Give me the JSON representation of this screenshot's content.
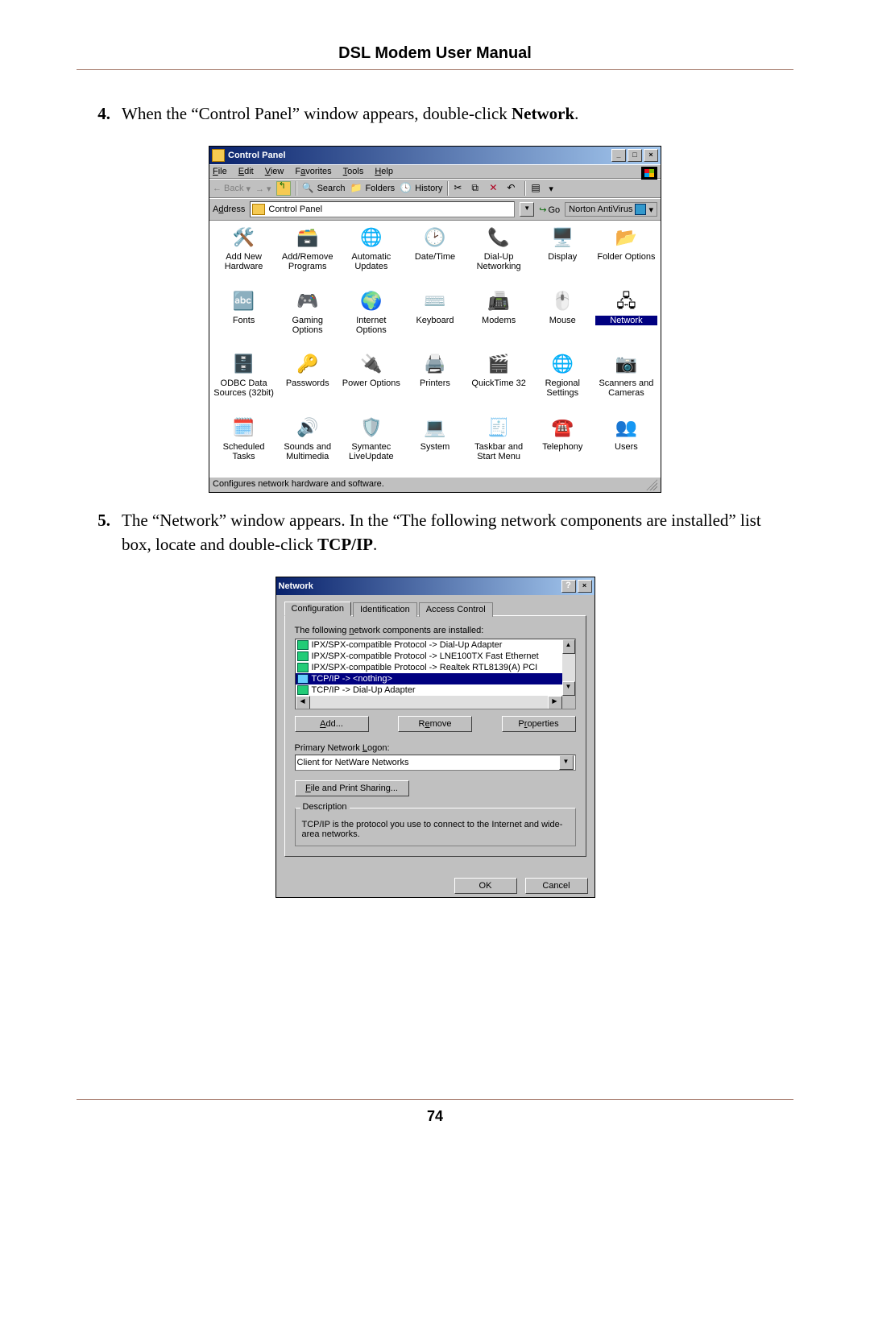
{
  "doc": {
    "title": "DSL Modem User Manual",
    "page": "74"
  },
  "steps": {
    "s4": {
      "num": "4.",
      "text_a": "When the “Control Panel” window appears, double-click ",
      "bold": "Network",
      "text_b": "."
    },
    "s5": {
      "num": "5.",
      "text_a": "The “Network” window appears. In the “The following network components are installed” list box, locate and double-click ",
      "bold": "TCP/IP",
      "text_b": "."
    }
  },
  "cpwin": {
    "title": "Control Panel",
    "menu": {
      "file": "File",
      "edit": "Edit",
      "view": "View",
      "fav": "Favorites",
      "tools": "Tools",
      "help": "Help"
    },
    "tb": {
      "back": "Back",
      "search": "Search",
      "folders": "Folders",
      "history": "History"
    },
    "addr": {
      "label": "Address",
      "value": "Control Panel",
      "go": "Go",
      "nav": "Norton AntiVirus"
    },
    "items": [
      {
        "icon": "🛠️",
        "label": "Add New Hardware"
      },
      {
        "icon": "🗃️",
        "label": "Add/Remove Programs"
      },
      {
        "icon": "🌐",
        "label": "Automatic Updates"
      },
      {
        "icon": "🕑",
        "label": "Date/Time"
      },
      {
        "icon": "📞",
        "label": "Dial-Up Networking"
      },
      {
        "icon": "🖥️",
        "label": "Display"
      },
      {
        "icon": "📂",
        "label": "Folder Options"
      },
      {
        "icon": "🔤",
        "label": "Fonts"
      },
      {
        "icon": "🎮",
        "label": "Gaming Options"
      },
      {
        "icon": "🌍",
        "label": "Internet Options"
      },
      {
        "icon": "⌨️",
        "label": "Keyboard"
      },
      {
        "icon": "📠",
        "label": "Modems"
      },
      {
        "icon": "🖱️",
        "label": "Mouse"
      },
      {
        "icon": "🖧",
        "label": "Network",
        "selected": true
      },
      {
        "icon": "🗄️",
        "label": "ODBC Data Sources (32bit)"
      },
      {
        "icon": "🔑",
        "label": "Passwords"
      },
      {
        "icon": "🔌",
        "label": "Power Options"
      },
      {
        "icon": "🖨️",
        "label": "Printers"
      },
      {
        "icon": "🎬",
        "label": "QuickTime 32"
      },
      {
        "icon": "🌐",
        "label": "Regional Settings"
      },
      {
        "icon": "📷",
        "label": "Scanners and Cameras"
      },
      {
        "icon": "🗓️",
        "label": "Scheduled Tasks"
      },
      {
        "icon": "🔊",
        "label": "Sounds and Multimedia"
      },
      {
        "icon": "🛡️",
        "label": "Symantec LiveUpdate"
      },
      {
        "icon": "💻",
        "label": "System"
      },
      {
        "icon": "🧾",
        "label": "Taskbar and Start Menu"
      },
      {
        "icon": "☎️",
        "label": "Telephony"
      },
      {
        "icon": "👥",
        "label": "Users"
      }
    ],
    "status": "Configures network hardware and software."
  },
  "netwin": {
    "title": "Network",
    "tabs": {
      "cfg": "Configuration",
      "id": "Identification",
      "ac": "Access Control"
    },
    "list_label": "The following network components are installed:",
    "components": [
      {
        "text": "IPX/SPX-compatible Protocol -> Dial-Up Adapter"
      },
      {
        "text": "IPX/SPX-compatible Protocol -> LNE100TX Fast Ethernet"
      },
      {
        "text": "IPX/SPX-compatible Protocol -> Realtek RTL8139(A) PCI"
      },
      {
        "text": "TCP/IP -> <nothing>",
        "selected": true,
        "kind": "net"
      },
      {
        "text": "TCP/IP -> Dial-Up Adapter"
      }
    ],
    "buttons": {
      "add": "Add...",
      "remove": "Remove",
      "props": "Properties"
    },
    "pnl": {
      "label": "Primary Network Logon:",
      "value": "Client for NetWare Networks"
    },
    "share": "File and Print Sharing...",
    "desc": {
      "legend": "Description",
      "text": "TCP/IP is the protocol you use to connect to the Internet and wide-area networks."
    },
    "ok": "OK",
    "cancel": "Cancel"
  }
}
